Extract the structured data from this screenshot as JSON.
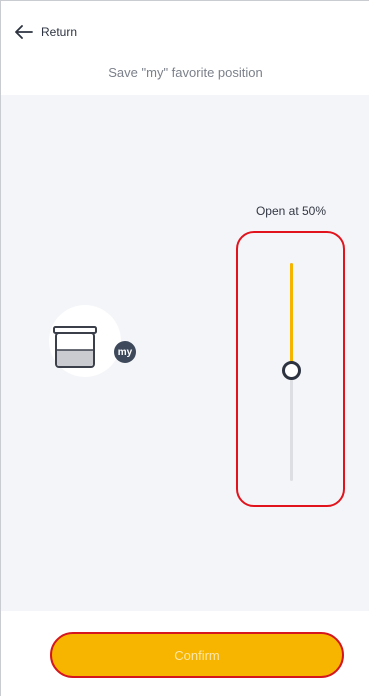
{
  "header": {
    "back_label": "Return",
    "subtitle": "Save \"my\" favorite position"
  },
  "slider": {
    "label": "Open at 50%",
    "value_percent": 50
  },
  "device": {
    "badge": "my"
  },
  "footer": {
    "confirm_label": "Confirm"
  },
  "colors": {
    "accent": "#f8b500",
    "highlight_border": "#e1141e",
    "background": "#f4f5f8",
    "badge": "#3e4a5c"
  },
  "icons": {
    "back": "arrow-left-icon",
    "device": "shutter-device-icon"
  }
}
